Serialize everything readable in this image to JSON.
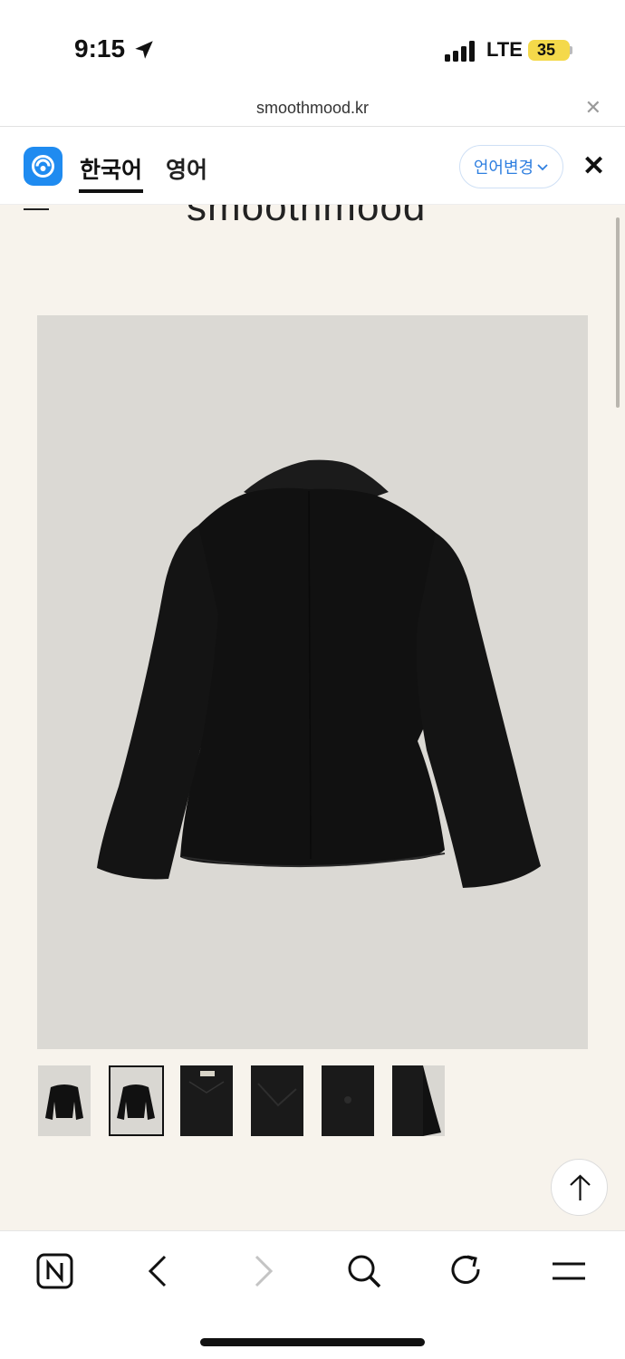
{
  "status_bar": {
    "time": "9:15",
    "network": "LTE",
    "battery": "35"
  },
  "browser": {
    "url": "smoothmood.kr",
    "close_icon": "close-icon"
  },
  "translate_bar": {
    "source_language": "한국어",
    "target_language": "영어",
    "change_language_label": "언어변경",
    "close_icon": "close-icon"
  },
  "site": {
    "brand": "smoothmood",
    "product_images": {
      "thumbnail_count": 6,
      "selected_index": 1
    }
  },
  "bottom_nav": {
    "items": [
      "naver-icon",
      "back-arrow-icon",
      "forward-arrow-icon",
      "search-icon",
      "refresh-icon",
      "menu-icon"
    ]
  },
  "colors": {
    "accent_blue": "#2f7fe0",
    "page_background": "#f7f3ec",
    "image_background": "#dbd9d4",
    "battery": "#f4d94a"
  }
}
